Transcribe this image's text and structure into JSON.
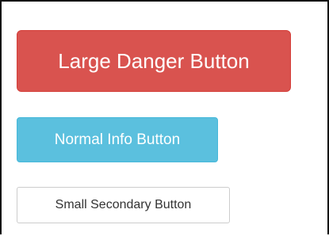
{
  "buttons": {
    "large_danger": {
      "label": "Large Danger Button",
      "color": "#d9534f"
    },
    "normal_info": {
      "label": "Normal Info Button",
      "color": "#5bc0de"
    },
    "small_secondary": {
      "label": "Small Secondary Button",
      "color": "#ffffff"
    }
  }
}
